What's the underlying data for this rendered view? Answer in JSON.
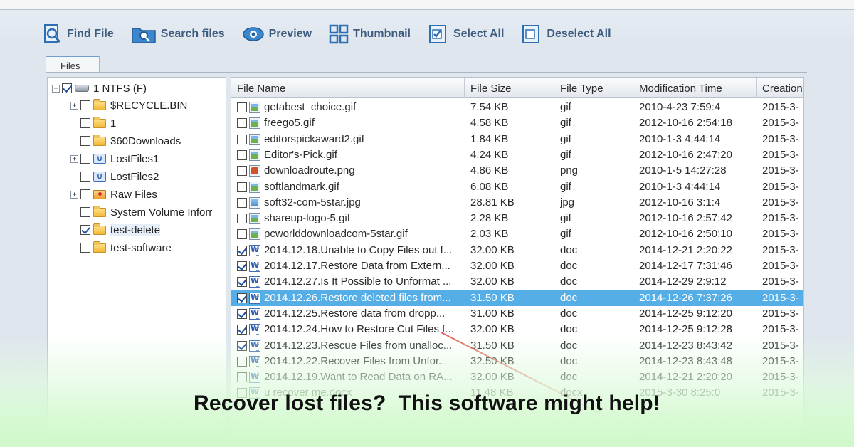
{
  "toolbar": {
    "find_file": "Find File",
    "search_files": "Search files",
    "preview": "Preview",
    "thumbnail": "Thumbnail",
    "select_all": "Select All",
    "deselect_all": "Deselect All"
  },
  "tabs": {
    "files": "Files"
  },
  "tree": {
    "root": {
      "label": "1 NTFS (F)",
      "checked": true
    },
    "items": [
      {
        "label": "$RECYCLE.BIN",
        "icon": "folder-icon",
        "expandable": true,
        "checked": false
      },
      {
        "label": "1",
        "icon": "folder-icon",
        "expandable": false,
        "checked": false
      },
      {
        "label": "360Downloads",
        "icon": "folder-icon",
        "expandable": false,
        "checked": false
      },
      {
        "label": "LostFiles1",
        "icon": "lost-files-icon",
        "expandable": true,
        "checked": false
      },
      {
        "label": "LostFiles2",
        "icon": "lost-files-icon",
        "expandable": false,
        "checked": false
      },
      {
        "label": "Raw Files",
        "icon": "raw-files-icon",
        "expandable": true,
        "checked": false
      },
      {
        "label": "System Volume Inforr",
        "icon": "folder-icon",
        "expandable": false,
        "checked": false
      },
      {
        "label": "test-delete",
        "icon": "folder-icon",
        "expandable": false,
        "checked": true
      },
      {
        "label": "test-software",
        "icon": "folder-icon",
        "expandable": false,
        "checked": false
      }
    ]
  },
  "table": {
    "columns": [
      "File Name",
      "File Size",
      "File Type",
      "Modification Time",
      "Creation"
    ],
    "rows": [
      {
        "name": "getabest_choice.gif",
        "size": "7.54 KB",
        "type": "gif",
        "mtime": "2010-4-23 7:59:4",
        "ctime": "2015-3-",
        "checked": false,
        "icon": "gif"
      },
      {
        "name": "freego5.gif",
        "size": "4.58 KB",
        "type": "gif",
        "mtime": "2012-10-16 2:54:18",
        "ctime": "2015-3-",
        "checked": false,
        "icon": "gif"
      },
      {
        "name": "editorspickaward2.gif",
        "size": "1.84 KB",
        "type": "gif",
        "mtime": "2010-1-3 4:44:14",
        "ctime": "2015-3-",
        "checked": false,
        "icon": "gif"
      },
      {
        "name": "Editor's-Pick.gif",
        "size": "4.24 KB",
        "type": "gif",
        "mtime": "2012-10-16 2:47:20",
        "ctime": "2015-3-",
        "checked": false,
        "icon": "gif"
      },
      {
        "name": "downloadroute.png",
        "size": "4.86 KB",
        "type": "png",
        "mtime": "2010-1-5 14:27:28",
        "ctime": "2015-3-",
        "checked": false,
        "icon": "png"
      },
      {
        "name": "softlandmark.gif",
        "size": "6.08 KB",
        "type": "gif",
        "mtime": "2010-1-3 4:44:14",
        "ctime": "2015-3-",
        "checked": false,
        "icon": "gif"
      },
      {
        "name": "soft32-com-5star.jpg",
        "size": "28.81 KB",
        "type": "jpg",
        "mtime": "2012-10-16 3:1:4",
        "ctime": "2015-3-",
        "checked": false,
        "icon": "jpg"
      },
      {
        "name": "shareup-logo-5.gif",
        "size": "2.28 KB",
        "type": "gif",
        "mtime": "2012-10-16 2:57:42",
        "ctime": "2015-3-",
        "checked": false,
        "icon": "gif"
      },
      {
        "name": "pcworlddownloadcom-5star.gif",
        "size": "2.03 KB",
        "type": "gif",
        "mtime": "2012-10-16 2:50:10",
        "ctime": "2015-3-",
        "checked": false,
        "icon": "gif"
      },
      {
        "name": "2014.12.18.Unable to Copy Files out f...",
        "size": "32.00 KB",
        "type": "doc",
        "mtime": "2014-12-21 2:20:22",
        "ctime": "2015-3-",
        "checked": true,
        "icon": "doc"
      },
      {
        "name": "2014.12.17.Restore Data from Extern...",
        "size": "32.00 KB",
        "type": "doc",
        "mtime": "2014-12-17 7:31:46",
        "ctime": "2015-3-",
        "checked": true,
        "icon": "doc"
      },
      {
        "name": "2014.12.27.Is It Possible to Unformat ...",
        "size": "32.00 KB",
        "type": "doc",
        "mtime": "2014-12-29 2:9:12",
        "ctime": "2015-3-",
        "checked": true,
        "icon": "doc"
      },
      {
        "name": "2014.12.26.Restore deleted files from...",
        "size": "31.50 KB",
        "type": "doc",
        "mtime": "2014-12-26 7:37:26",
        "ctime": "2015-3-",
        "checked": true,
        "icon": "doc",
        "selected": true
      },
      {
        "name": "2014.12.25.Restore data from dropp...",
        "size": "31.00 KB",
        "type": "doc",
        "mtime": "2014-12-25 9:12:20",
        "ctime": "2015-3-",
        "checked": true,
        "icon": "doc"
      },
      {
        "name": "2014.12.24.How to Restore Cut Files f...",
        "size": "32.00 KB",
        "type": "doc",
        "mtime": "2014-12-25 9:12:28",
        "ctime": "2015-3-",
        "checked": true,
        "icon": "doc"
      },
      {
        "name": "2014.12.23.Rescue Files from unalloc...",
        "size": "31.50 KB",
        "type": "doc",
        "mtime": "2014-12-23 8:43:42",
        "ctime": "2015-3-",
        "checked": true,
        "icon": "doc"
      },
      {
        "name": "2014.12.22.Recover Files from Unfor...",
        "size": "32.50 KB",
        "type": "doc",
        "mtime": "2014-12-23 8:43:48",
        "ctime": "2015-3-",
        "checked": false,
        "icon": "doc"
      },
      {
        "name": "2014.12.19.Want to Read Data on RA...",
        "size": "32.00 KB",
        "type": "doc",
        "mtime": "2014-12-21 2:20:20",
        "ctime": "2015-3-",
        "checked": false,
        "icon": "doc"
      },
      {
        "name": "u recover me.docx",
        "size": "11.48 KB",
        "type": "docx",
        "mtime": "2015-3-30 8:25:0",
        "ctime": "2015-3-",
        "checked": false,
        "icon": "doc"
      }
    ]
  },
  "caption": "Recover lost files?  This software might help!",
  "colors": {
    "selection": "#55aee6",
    "toolbar_text": "#3f5e7f",
    "fade": "#cff8cb"
  }
}
